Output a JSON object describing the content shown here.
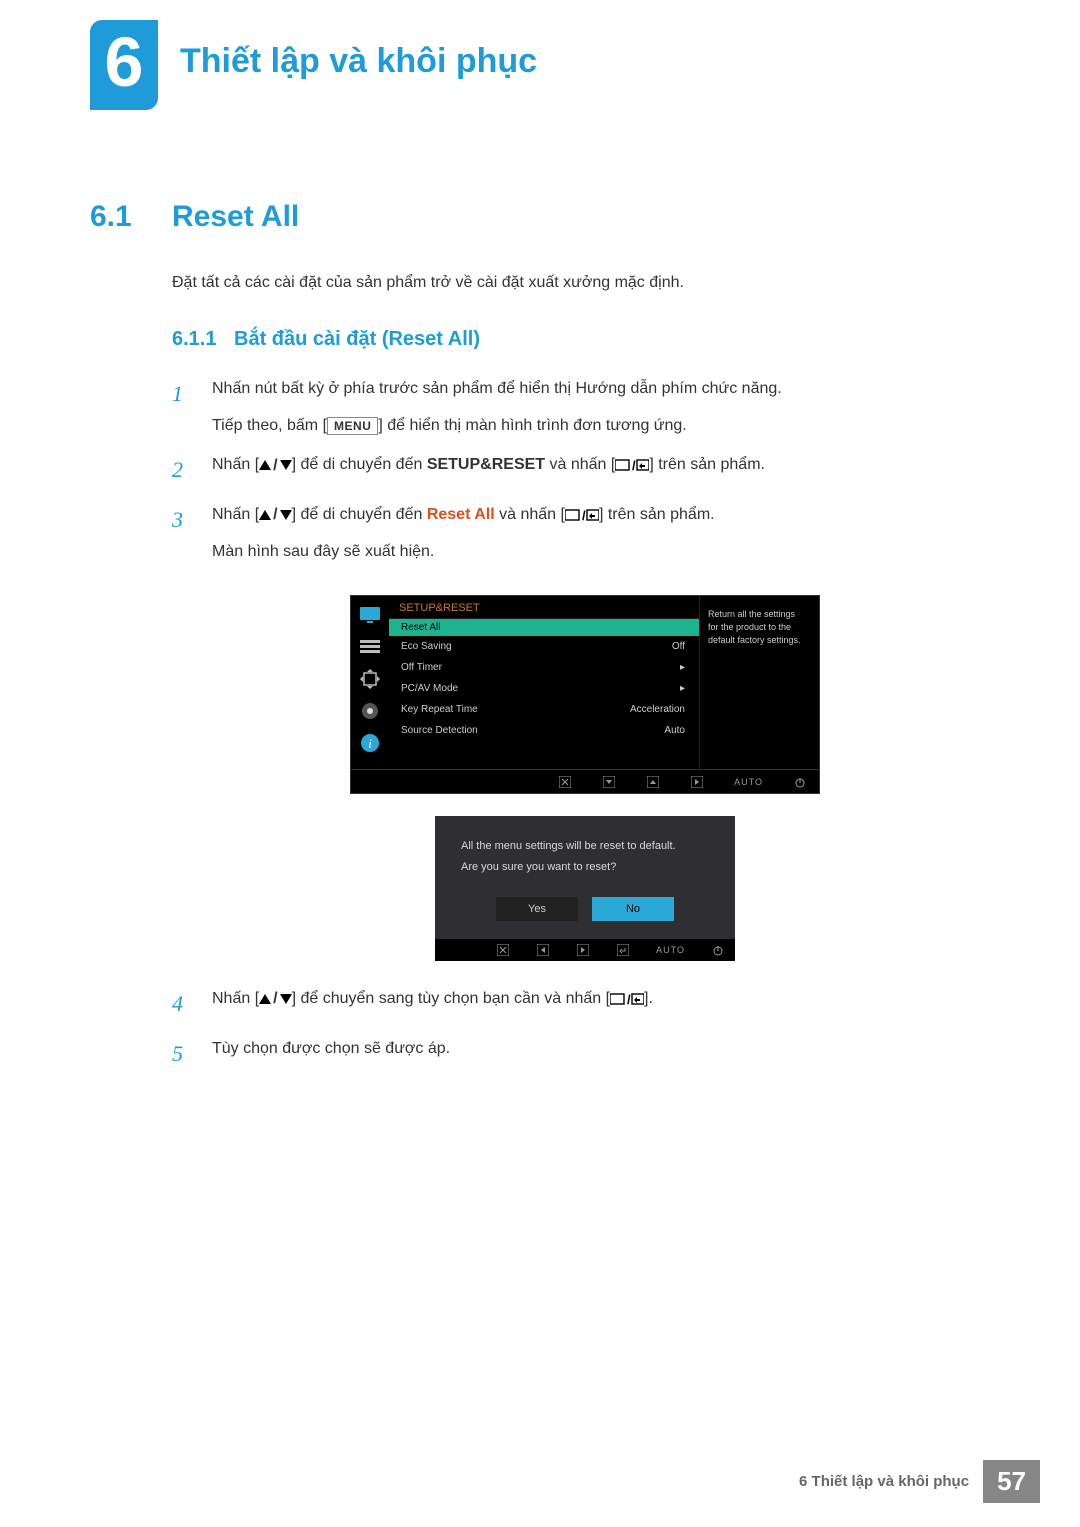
{
  "chapter": {
    "number": "6",
    "title": "Thiết lập và khôi phục"
  },
  "section": {
    "number": "6.1",
    "title": "Reset All",
    "desc": "Đặt tất cả các cài đặt của sản phẩm trở về cài đặt xuất xưởng mặc định."
  },
  "subsection": {
    "number": "6.1.1",
    "title": "Bắt đầu cài đặt (Reset All)"
  },
  "steps": {
    "s1": {
      "n": "1",
      "a": "Nhấn nút bất kỳ ở phía trước sản phẩm để hiển thị Hướng dẫn phím chức năng.",
      "b1": "Tiếp theo, bấm [",
      "menu": "MENU",
      "b2": "] để hiển thị màn hình trình đơn tương ứng."
    },
    "s2": {
      "n": "2",
      "a": "Nhấn [",
      "b": "] để di chuyển đến ",
      "kw": "SETUP&RESET",
      "c": " và nhấn [",
      "d": "] trên sản phẩm."
    },
    "s3": {
      "n": "3",
      "a": "Nhấn [",
      "b": "] để di chuyển đến ",
      "kw": "Reset All",
      "c": " và nhấn [",
      "d": "] trên sản phẩm.",
      "e": "Màn hình sau đây sẽ xuất hiện."
    },
    "s4": {
      "n": "4",
      "a": "Nhấn [",
      "b": "] để chuyển sang tùy chọn bạn cần và nhấn [",
      "c": "]."
    },
    "s5": {
      "n": "5",
      "a": "Tùy chọn được chọn sẽ được áp."
    }
  },
  "osd": {
    "head": "SETUP&RESET",
    "rows": {
      "r0": {
        "label": "Reset All",
        "val": ""
      },
      "r1": {
        "label": "Eco Saving",
        "val": "Off"
      },
      "r2": {
        "label": "Off Timer",
        "val": "▸"
      },
      "r3": {
        "label": "PC/AV Mode",
        "val": "▸"
      },
      "r4": {
        "label": "Key Repeat Time",
        "val": "Acceleration"
      },
      "r5": {
        "label": "Source Detection",
        "val": "Auto"
      }
    },
    "info1": "Return all the settings",
    "info2": "for the product to the",
    "info3": "default factory settings.",
    "auto": "AUTO"
  },
  "dialog": {
    "line1": "All the menu settings will be reset to default.",
    "line2": "Are you sure you want to reset?",
    "yes": "Yes",
    "no": "No",
    "auto": "AUTO"
  },
  "footer": {
    "label": "6 Thiết lập và khôi phục",
    "page": "57"
  }
}
